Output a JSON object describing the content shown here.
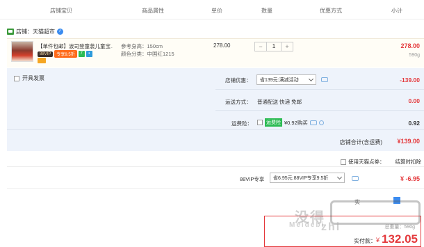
{
  "header": {
    "col_item": "店铺宝贝",
    "col_attr": "商品属性",
    "col_price": "单价",
    "col_qty": "数量",
    "col_promo": "优惠方式",
    "col_subtotal": "小计"
  },
  "shop": {
    "label": "店铺：天猫超市"
  },
  "item": {
    "title": "【单件包邮】波司登童装儿童宝...",
    "tag_vip": "88VIP",
    "tag_promo": "专享9.5折",
    "tag_g": "7",
    "attr_height": "参考身高：150cm",
    "attr_color": "颜色分类：中国红1215",
    "unit_price": "278.00",
    "qty_minus": "−",
    "qty_value": "1",
    "qty_plus": "+",
    "subtotal": "278.00",
    "weight": "590g"
  },
  "panel": {
    "invoice": "开具发票",
    "shop_discount_label": "店铺优惠：",
    "shop_discount_select": "省139元:满减活动",
    "shop_discount_value": "-139.00",
    "shipping_label": "运送方式：",
    "shipping_value_text": "普通配送 快递 免邮",
    "shipping_fee": "0.00",
    "insurance_label": "运费险：",
    "insurance_badge": "运费险",
    "insurance_text": "¥0.92购买",
    "insurance_value": "0.92",
    "shop_total_label": "店铺合计(含运费)",
    "shop_total_value": "¥139.00"
  },
  "tmall_points": {
    "label": "使用天猫点券：",
    "right_text": "结算时扣除"
  },
  "vip": {
    "label": "88VIP专享",
    "select": "省6.95元:88VIP专享9.5折",
    "value": "¥ -6.95"
  },
  "bottom": {
    "partial_text": "实",
    "weight_text": "总重量：590g",
    "pay_label": "实付款：",
    "pay_currency": "¥",
    "pay_value": "132.05"
  },
  "watermark": {
    "text1": "没得",
    "text2": "Meidebi",
    "text3": "zhi"
  }
}
